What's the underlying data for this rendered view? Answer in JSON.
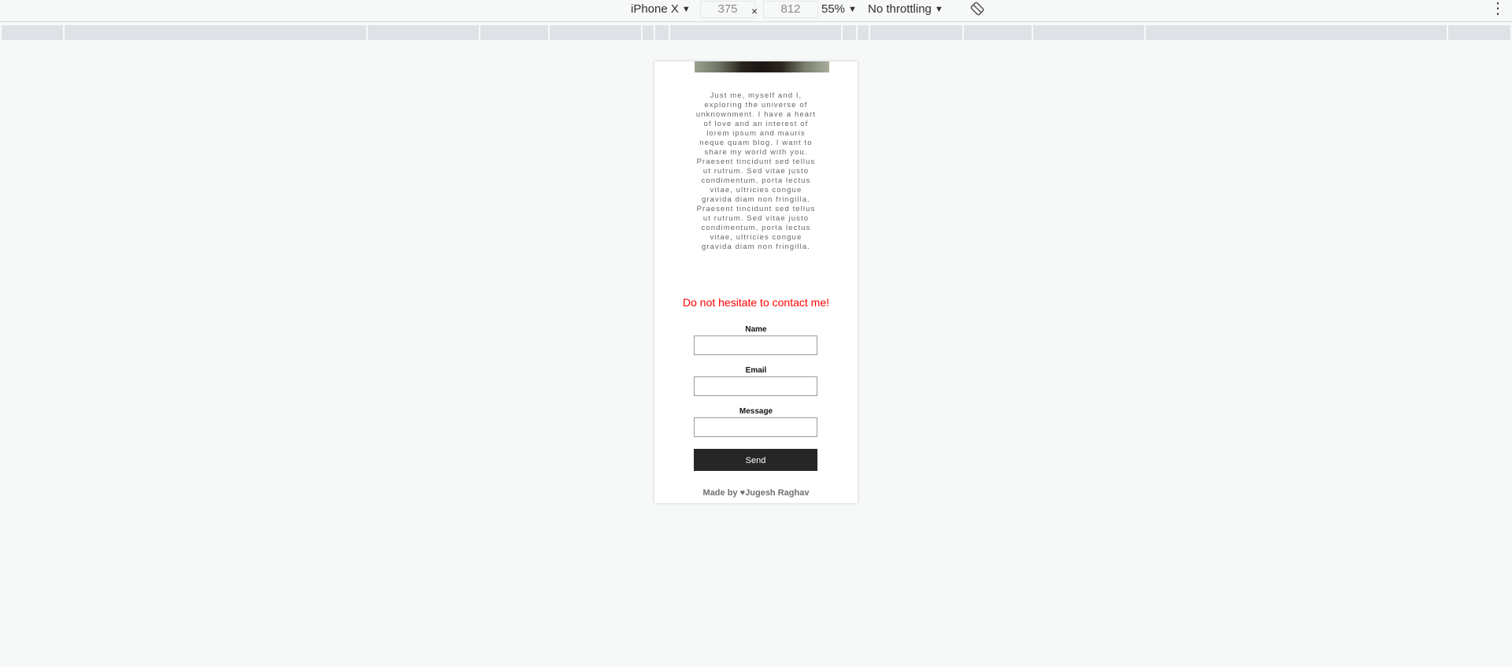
{
  "devtools": {
    "device": "iPhone X",
    "width": "375",
    "height": "812",
    "times_sign": "×",
    "zoom": "55%",
    "throttling": "No throttling",
    "icons": [
      "rotate-icon",
      "more-vertical-icon"
    ]
  },
  "page": {
    "bio": "Just me, myself and I, exploring the universe of unknownment. I have a heart of love and an interest of lorem ipsum and mauris neque quam blog. I want to share my world with you. Praesent tincidunt sed tellus ut rutrum. Sed vitae justo condimentum, porta lectus vitae, ultricies congue gravida diam non fringilla. Praesent tincidunt sed tellus ut rutrum. Sed vitae justo condimentum, porta lectus vitae, ultricies congue gravida diam non fringilla.",
    "contact_heading": "Do not hesitate to contact me!",
    "contact_heading_color": "#ff0000",
    "form": {
      "name_label": "Name",
      "email_label": "Email",
      "message_label": "Message",
      "send_label": "Send"
    },
    "footer": {
      "made_by": "Made by ",
      "heart": "♥",
      "author": "Jugesh Raghav"
    }
  }
}
